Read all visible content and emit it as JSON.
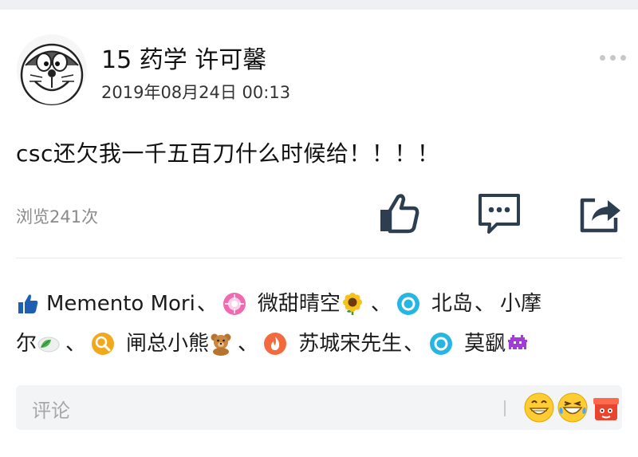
{
  "post": {
    "author": "15 药学 许可馨",
    "timestamp": "2019年08月24日 00:13",
    "content": "csc还欠我一千五百刀什么时候给！！！！",
    "views": "浏览241次"
  },
  "actions": {
    "like_icon": "thumbs-up-icon",
    "comment_icon": "comment-icon",
    "share_icon": "share-icon",
    "more_icon": "more-icon"
  },
  "likers": [
    {
      "name": "Memento Mori",
      "icon": "flower-avatar-icon"
    },
    {
      "name": "微甜晴空",
      "icon": "sunflower-emoji-icon"
    },
    {
      "name": "北岛",
      "icon": "ring-avatar-icon"
    },
    {
      "name": "小摩尔",
      "icon": "leaf-emoji-icon"
    },
    {
      "name": "闸总小熊",
      "icon": "bear-emoji-icon"
    },
    {
      "name": "苏城宋先生",
      "icon": "ring-avatar-icon"
    },
    {
      "name": "莫飖",
      "icon": "space-invader-emoji-icon"
    }
  ],
  "separator": "、",
  "comment_bar": {
    "placeholder": "评论",
    "emojis": [
      "grin-emoji-icon",
      "laugh-cry-emoji-icon",
      "box-emoji-icon"
    ]
  },
  "colors": {
    "accent_blue": "#1f5fb3",
    "icon_dark": "#2d3e50",
    "muted_text": "#8a8a8a"
  }
}
